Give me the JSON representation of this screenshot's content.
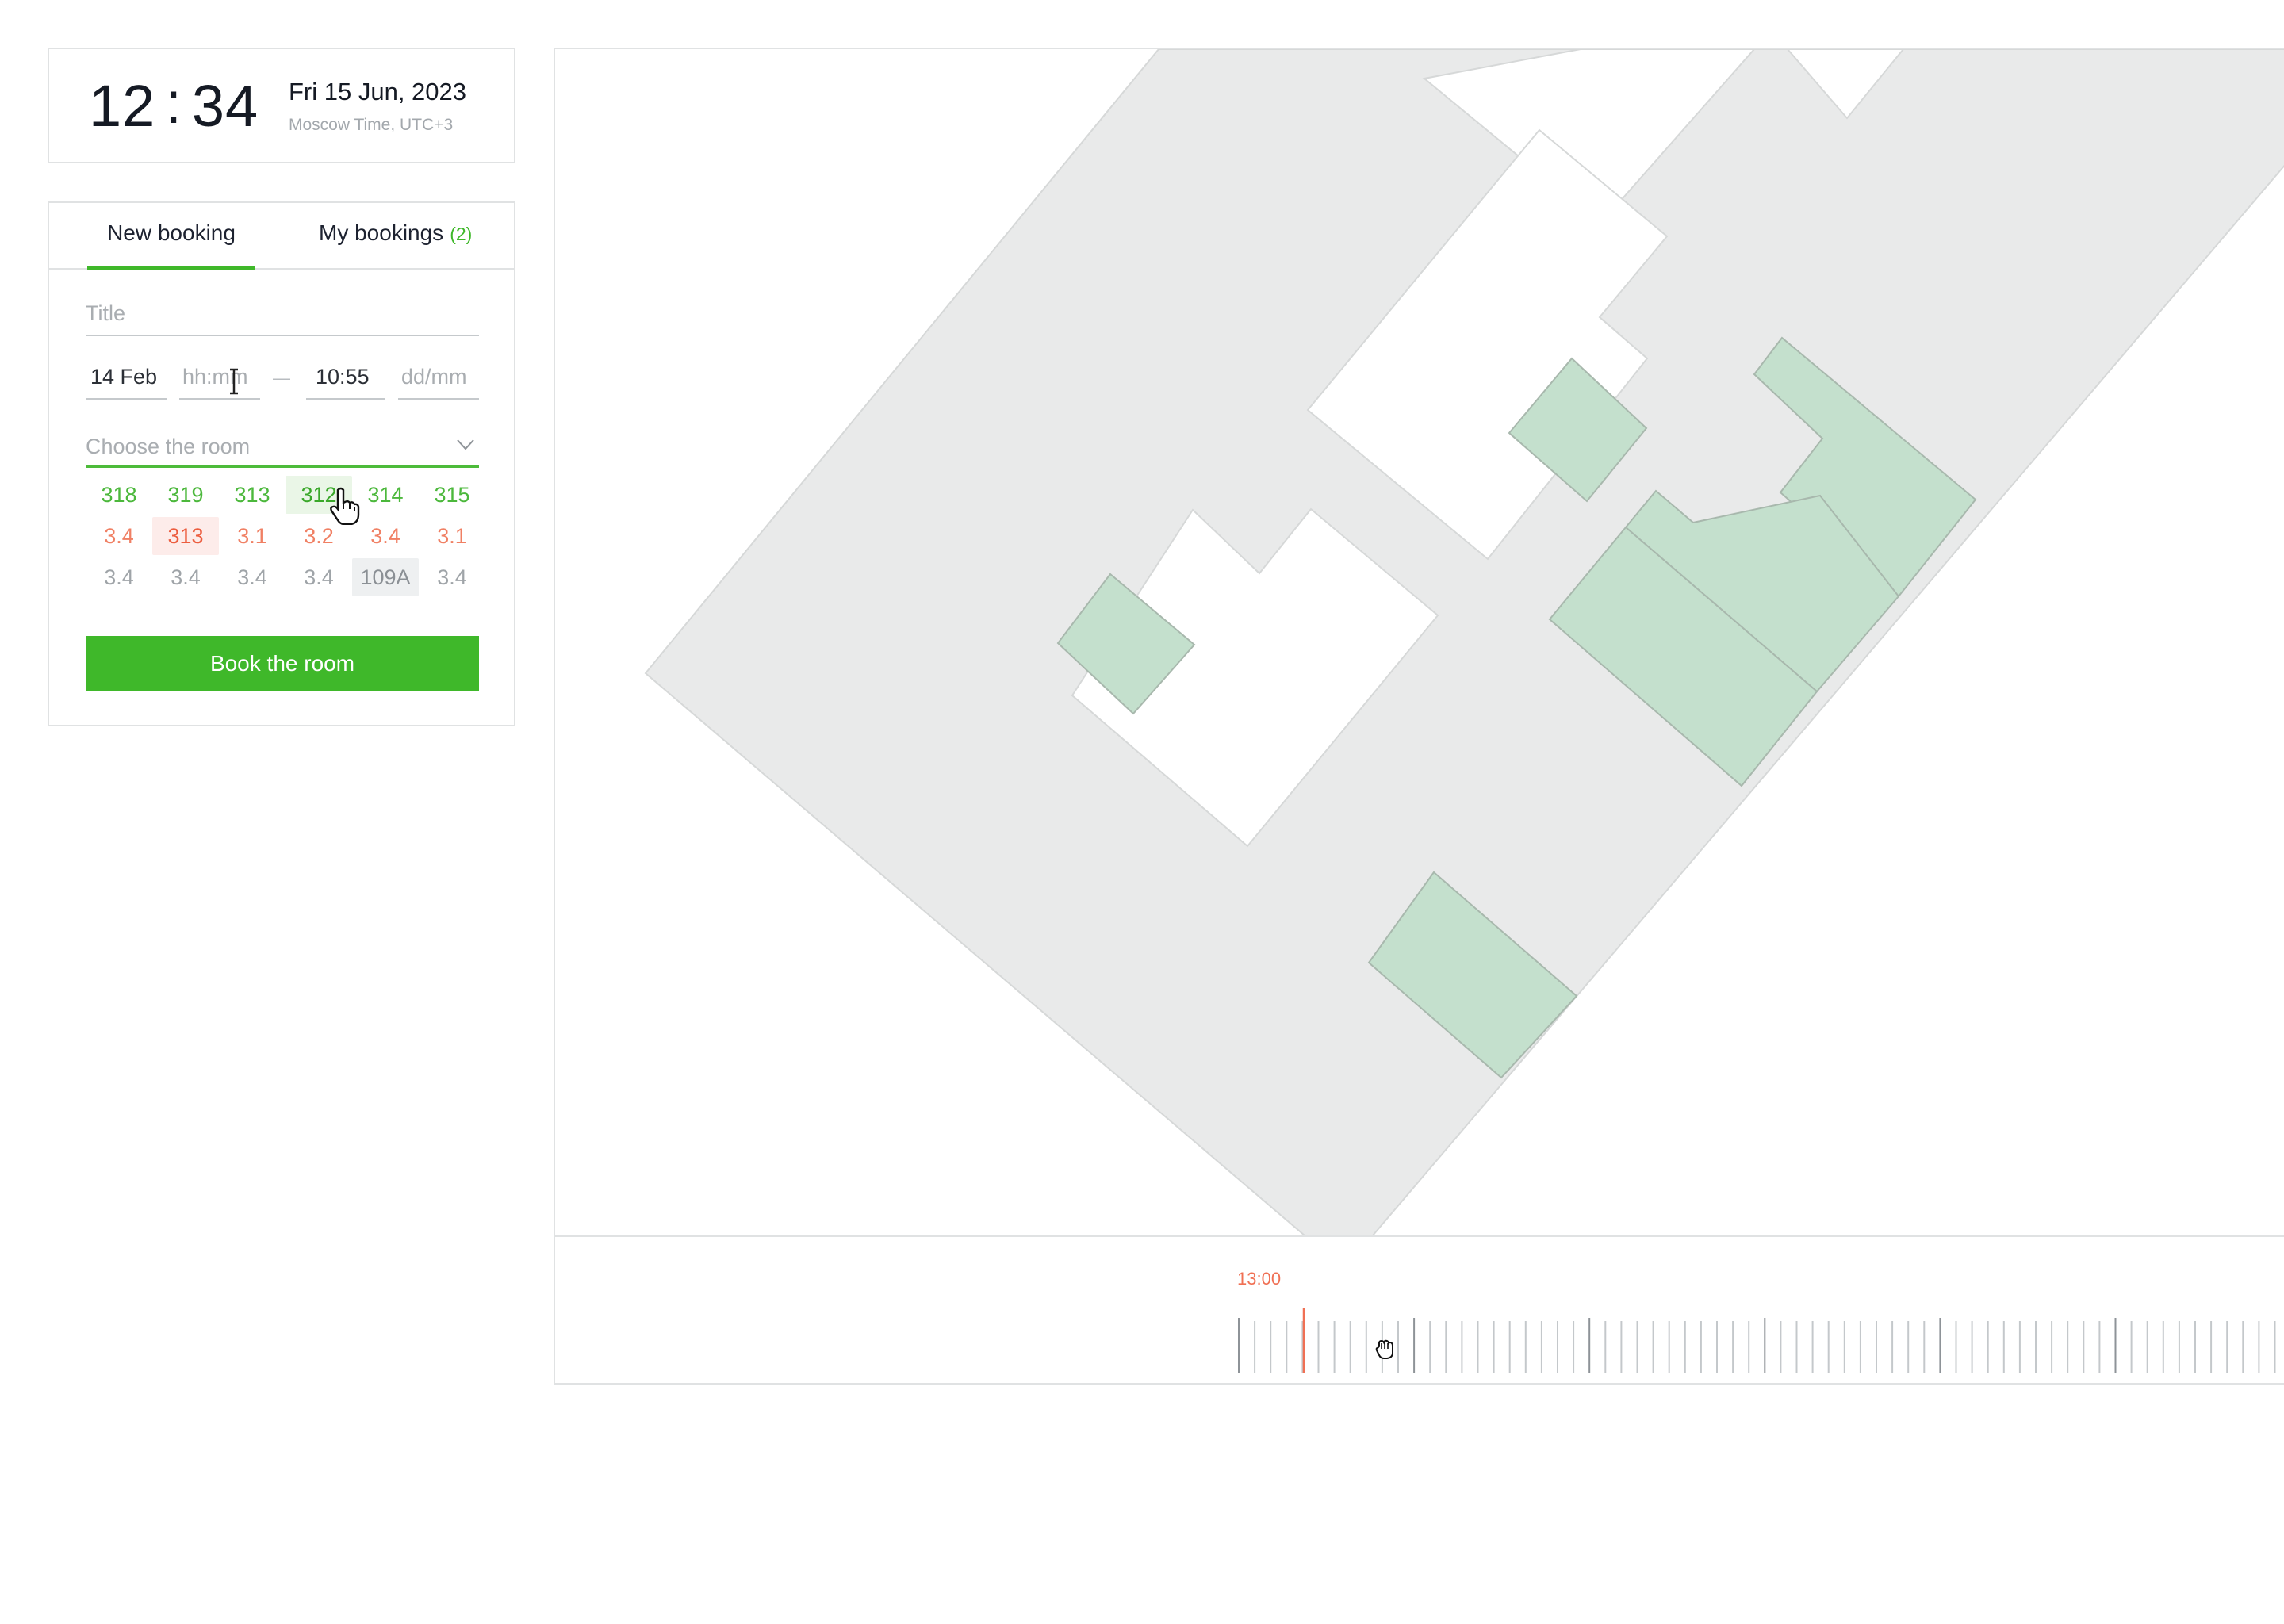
{
  "clock": {
    "hours": "12",
    "separator": ":",
    "minutes": "34",
    "date": "Fri 15 Jun, 2023",
    "timezone": "Moscow Time, UTC+3"
  },
  "booking": {
    "tabs": {
      "new_label": "New booking",
      "my_label": "My bookings",
      "my_count": "(2)"
    },
    "title_placeholder": "Title",
    "start_date": "14 Feb",
    "start_time_placeholder": "hh:mm",
    "range_separator": "—",
    "end_time": "10:55",
    "end_date_placeholder": "dd/mm",
    "room_select_placeholder": "Choose the room",
    "rooms": [
      [
        {
          "label": "318",
          "status": "free"
        },
        {
          "label": "319",
          "status": "free"
        },
        {
          "label": "313",
          "status": "free"
        },
        {
          "label": "312",
          "status": "hover-free"
        },
        {
          "label": "314",
          "status": "free"
        },
        {
          "label": "315",
          "status": "free"
        }
      ],
      [
        {
          "label": "3.4",
          "status": "busy"
        },
        {
          "label": "313",
          "status": "hover-busy"
        },
        {
          "label": "3.1",
          "status": "busy"
        },
        {
          "label": "3.2",
          "status": "busy"
        },
        {
          "label": "3.4",
          "status": "busy"
        },
        {
          "label": "3.1",
          "status": "busy"
        }
      ],
      [
        {
          "label": "3.4",
          "status": "na"
        },
        {
          "label": "3.4",
          "status": "na"
        },
        {
          "label": "3.4",
          "status": "na"
        },
        {
          "label": "3.4",
          "status": "na"
        },
        {
          "label": "109A",
          "status": "hover-na"
        },
        {
          "label": "3.4",
          "status": "na"
        }
      ]
    ],
    "book_button_label": "Book the room"
  },
  "map": {
    "colors": {
      "floor": "#e9eaea",
      "room_free": "#c4e0cd",
      "wall": "#c8cccc",
      "accent": "#3fb82a",
      "busy": "#f07054"
    }
  },
  "timeline": {
    "now_label": "13:00"
  },
  "icons": {
    "room_select": "chevron-down-icon",
    "pointer_cursor": "hand-pointer-icon",
    "text_cursor": "text-cursor-icon",
    "grab_cursor": "grab-hand-icon"
  }
}
